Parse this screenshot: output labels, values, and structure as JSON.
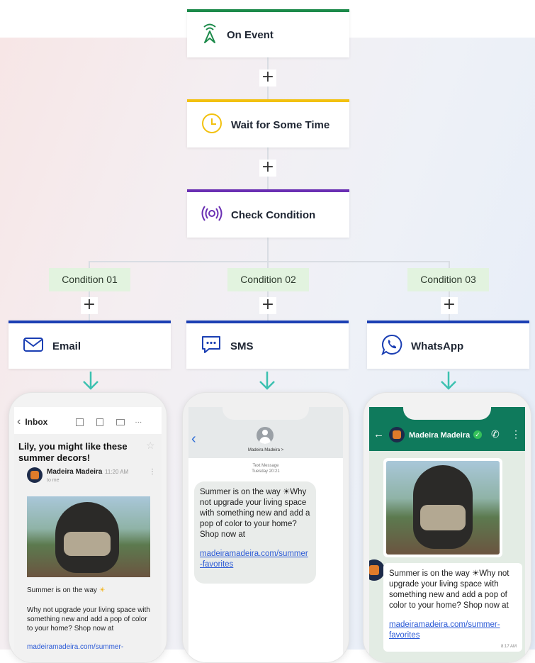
{
  "nodes": {
    "on_event": {
      "label": "On Event",
      "accent": "#1c8a4a"
    },
    "wait": {
      "label": "Wait for Some Time",
      "accent": "#f2c10f"
    },
    "check": {
      "label": "Check Condition",
      "accent": "#6a2fb3"
    },
    "email": {
      "label": "Email",
      "accent": "#1b3fb3"
    },
    "sms": {
      "label": "SMS",
      "accent": "#1b3fb3"
    },
    "whatsapp": {
      "label": "WhatsApp",
      "accent": "#1b3fb3"
    }
  },
  "conditions": [
    "Condition 01",
    "Condition 02",
    "Condition 03"
  ],
  "plus_symbol": "+",
  "email_phone": {
    "back_label": "Inbox",
    "subject": "Lily, you might like these summer decors!",
    "sender": "Madeira Madeira",
    "time": "11:20 AM",
    "to": "to me",
    "body1": "Summer is on the way",
    "body2": "Why not upgrade your living space with something new and add a pop of color to your home? Shop now at",
    "link": "madeiramadeira.com/summer-"
  },
  "sms_phone": {
    "contact": "Madeira Madeira >",
    "meta1": "Text Message",
    "meta2": "Tuesday  20:21",
    "message": "Summer is on the way ☀Why not upgrade your living space with something new and add a pop of color to your home? Shop now at",
    "link": "madeiramadeira.com/summer-favorites"
  },
  "whatsapp_phone": {
    "contact": "Madeira Madeira",
    "message": "Summer is on the way ☀Why not upgrade your living space with something new and add a pop of color to your home? Shop now at",
    "link": "madeiramadeira.com/summer-favorites",
    "time": "8:17 AM",
    "header_color": "#0f7a5c"
  },
  "colors": {
    "arrow": "#3cc1b0",
    "link": "#2b5ad6"
  }
}
